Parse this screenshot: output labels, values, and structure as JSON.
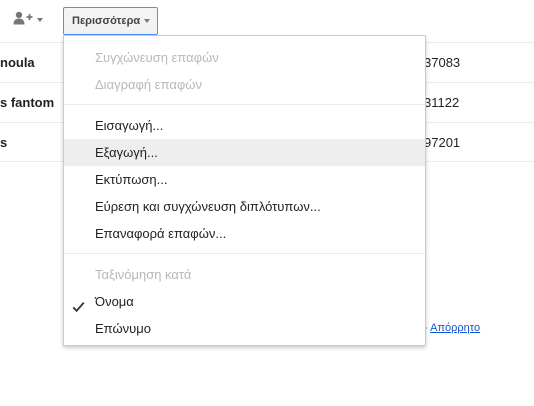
{
  "toolbar": {
    "add_contact_icon": "person-add-icon",
    "more_button_label": "Περισσότερα"
  },
  "contacts": [
    {
      "name": "noula",
      "phone": "37083"
    },
    {
      "name": "s fantom",
      "phone": "31122"
    },
    {
      "name": "s",
      "phone": "97201"
    }
  ],
  "footer": {
    "separator": "-",
    "privacy_link": "Απόρρητο"
  },
  "more_menu": {
    "group1": [
      {
        "label": "Συγχώνευση επαφών",
        "disabled": true
      },
      {
        "label": "Διαγραφή επαφών",
        "disabled": true
      }
    ],
    "group2": [
      {
        "label": "Εισαγωγή..."
      },
      {
        "label": "Εξαγωγή...",
        "highlighted": true
      },
      {
        "label": "Εκτύπωση..."
      },
      {
        "label": "Εύρεση και συγχώνευση διπλότυπων..."
      },
      {
        "label": "Επαναφορά επαφών..."
      }
    ],
    "sort_header": "Ταξινόμηση κατά",
    "sort_options": [
      {
        "label": "Όνομα",
        "checked": true
      },
      {
        "label": "Επώνυμο",
        "checked": false
      }
    ]
  },
  "colors": {
    "focus_border": "#4d90fe",
    "hover_bg": "#eeeeee",
    "disabled_text": "#b8b8b8",
    "link": "#1155cc"
  }
}
